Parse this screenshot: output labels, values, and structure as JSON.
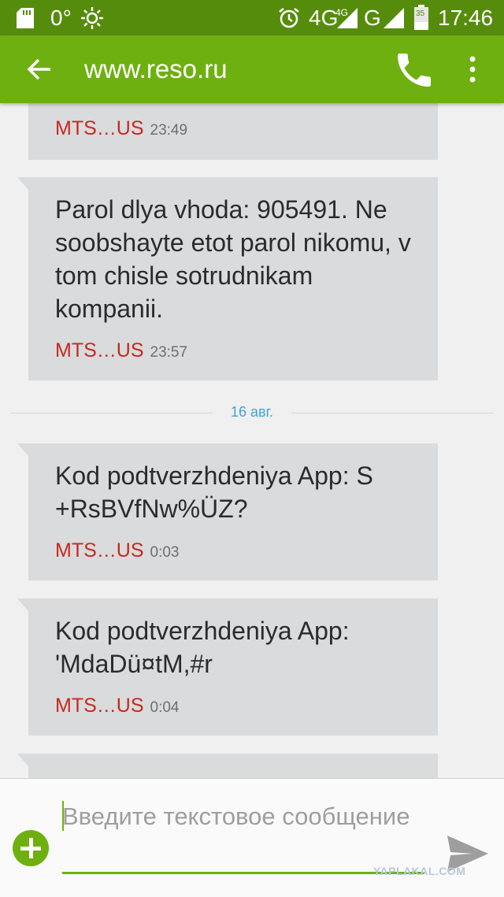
{
  "status_bar": {
    "temperature": "0°",
    "network_primary": "4G",
    "network_secondary": "4G",
    "network_g": "G",
    "battery_level": "35",
    "clock": "17:46",
    "icons": [
      "sd-card-icon",
      "sun-icon",
      "alarm-icon",
      "signal-icon",
      "battery-icon"
    ]
  },
  "app_bar": {
    "title": "www.reso.ru",
    "icons": [
      "back-arrow-icon",
      "phone-icon",
      "more-vertical-icon"
    ],
    "color": "#6eb010"
  },
  "messages": [
    {
      "text": "",
      "sender": "MTS…US",
      "time": "23:49"
    },
    {
      "text": "Parol dlya vhoda: 905491. Ne soobshayte etot parol nikomu, v tom chisle sotrudnikam kompanii.",
      "sender": "MTS…US",
      "time": "23:57"
    },
    {
      "text": "Kod podtverzhdeniya App: S +RsBVfNw%ÜZ?",
      "sender": "MTS…US",
      "time": "0:03"
    },
    {
      "text": "Kod podtverzhdeniya App: 'MdaDü¤tM,#r",
      "sender": "MTS…US",
      "time": "0:04"
    }
  ],
  "date_divider": "16 авг.",
  "composer": {
    "placeholder": "Введите текстовое сообщение",
    "icons": [
      "add-icon",
      "send-icon"
    ]
  },
  "watermark": "YAPLAKAL.COM",
  "colors": {
    "status_bar": "#568c0c",
    "accent": "#6eb010",
    "sender": "#c8291e",
    "bubble": "#d9dbdd",
    "date": "#3aa6d6"
  }
}
